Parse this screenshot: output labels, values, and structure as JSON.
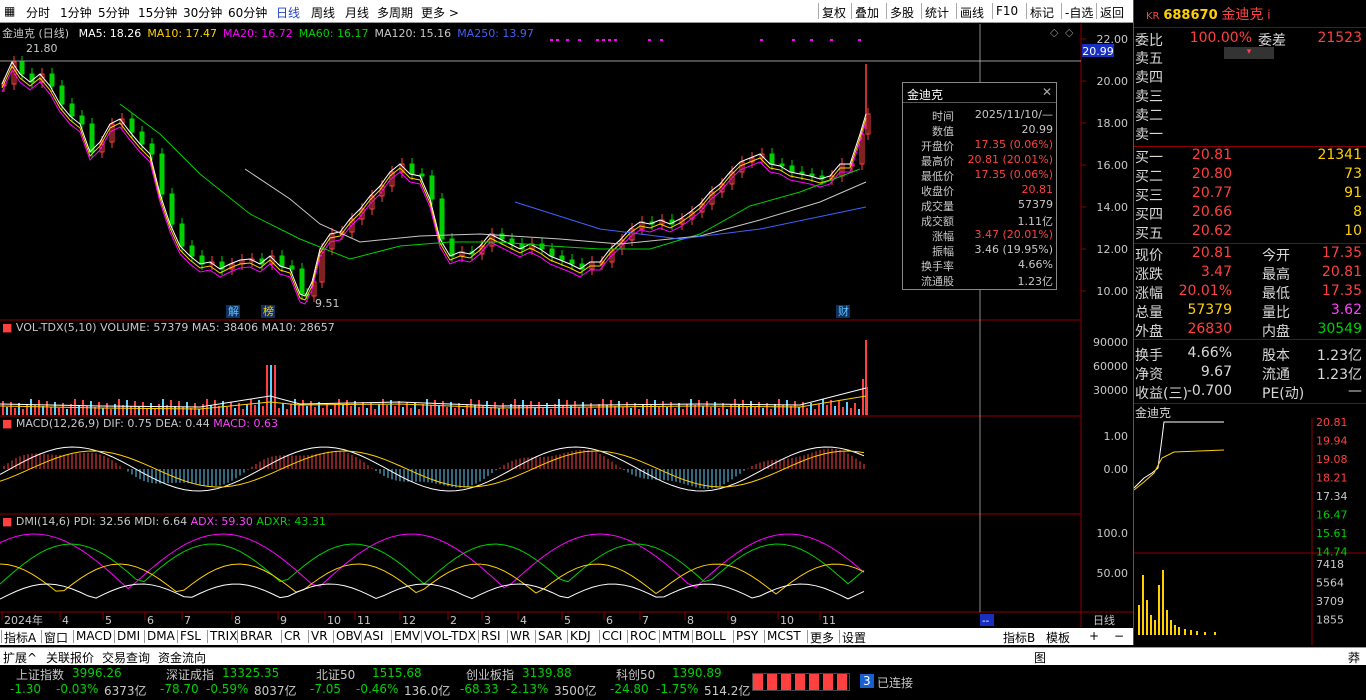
{
  "toolbar": {
    "periods": [
      "分时",
      "1分钟",
      "5分钟",
      "15分钟",
      "30分钟",
      "60分钟",
      "日线",
      "周线",
      "月线",
      "多周期",
      "更多 >"
    ],
    "active_period": "日线",
    "actions": [
      "复权",
      "叠加",
      "多股",
      "统计",
      "画线",
      "F10",
      "标记",
      "-自选",
      "返回"
    ]
  },
  "chart": {
    "title": "金迪克 (日线)",
    "ma": [
      {
        "label": "MA5: 18.26",
        "color": "#ffffff"
      },
      {
        "label": "MA10: 17.47",
        "color": "#ffd000"
      },
      {
        "label": "MA20: 16.72",
        "color": "#ff00ff"
      },
      {
        "label": "MA60: 16.17",
        "color": "#00d000"
      },
      {
        "label": "MA120: 15.16",
        "color": "#c8c8c8"
      },
      {
        "label": "MA250: 13.97",
        "color": "#4060ff"
      }
    ],
    "price_axis": [
      "22.00",
      "20.00",
      "18.00",
      "16.00",
      "14.00",
      "12.00",
      "10.00"
    ],
    "current_price_tag": "20.99",
    "high_label": "21.80",
    "low_label": "9.51",
    "peak_label": "21.80",
    "events": [
      "解",
      "榜",
      "财"
    ],
    "date_axis": [
      "2024年",
      "4",
      "5",
      "6",
      "7",
      "8",
      "9",
      "10",
      "11",
      "12",
      "2",
      "3",
      "4",
      "5",
      "6",
      "7",
      "8",
      "9",
      "10",
      "11"
    ],
    "timeframe_tag": "日线",
    "cursor_tag": "--"
  },
  "volume": {
    "title": "VOL-TDX(5,10)",
    "vol": "VOLUME: 57379",
    "ma5": "MA5: 38406",
    "ma10": "MA10: 28657",
    "axis": [
      "90000",
      "60000",
      "30000"
    ]
  },
  "macd": {
    "title": "MACD(12,26,9)",
    "dif": "DIF: 0.75",
    "dea": "DEA: 0.44",
    "macd": "MACD: 0.63",
    "axis": [
      "1.00",
      "0.00"
    ]
  },
  "dmi": {
    "title": "DMI(14,6)",
    "pdi": "PDI: 32.56",
    "mdi": "MDI: 6.64",
    "adx": "ADX: 59.30",
    "adxr": "ADXR: 43.31",
    "axis": [
      "100.0",
      "50.00"
    ]
  },
  "popup": {
    "title": "金迪克",
    "close_icon": "✕",
    "rows": [
      {
        "k": "时间",
        "v": "2025/11/10/—",
        "c": "#c8c8c8"
      },
      {
        "k": "数值",
        "v": "20.99",
        "c": "#c8c8c8"
      },
      {
        "k": "开盘价",
        "v": "17.35 (0.06%)",
        "c": "#ff4040"
      },
      {
        "k": "最高价",
        "v": "20.81 (20.01%)",
        "c": "#ff4040"
      },
      {
        "k": "最低价",
        "v": "17.35 (0.06%)",
        "c": "#ff4040"
      },
      {
        "k": "收盘价",
        "v": "20.81",
        "c": "#ff4040"
      },
      {
        "k": "成交量",
        "v": "57379",
        "c": "#c8c8c8"
      },
      {
        "k": "成交额",
        "v": "1.11亿",
        "c": "#c8c8c8"
      },
      {
        "k": "涨幅",
        "v": "3.47 (20.01%)",
        "c": "#ff4040"
      },
      {
        "k": "振幅",
        "v": "3.46 (19.95%)",
        "c": "#c8c8c8"
      },
      {
        "k": "换手率",
        "v": "4.66%",
        "c": "#c8c8c8"
      },
      {
        "k": "流通股",
        "v": "1.23亿",
        "c": "#c8c8c8"
      }
    ]
  },
  "quote": {
    "kr": "KR",
    "code": "688670",
    "name": "金迪克",
    "info": "i",
    "weibi_label": "委比",
    "weibi": "100.00%",
    "weicha_label": "委差",
    "weicha": "21523",
    "sells": [
      {
        "l": "卖五",
        "p": "",
        "q": ""
      },
      {
        "l": "卖四",
        "p": "",
        "q": ""
      },
      {
        "l": "卖三",
        "p": "",
        "q": ""
      },
      {
        "l": "卖二",
        "p": "",
        "q": ""
      },
      {
        "l": "卖一",
        "p": "",
        "q": ""
      }
    ],
    "buys": [
      {
        "l": "买一",
        "p": "20.81",
        "q": "21341"
      },
      {
        "l": "买二",
        "p": "20.80",
        "q": "73"
      },
      {
        "l": "买三",
        "p": "20.77",
        "q": "91"
      },
      {
        "l": "买四",
        "p": "20.66",
        "q": "8"
      },
      {
        "l": "买五",
        "p": "20.62",
        "q": "10"
      }
    ],
    "stats": [
      {
        "a": "现价",
        "av": "20.81",
        "ac": "#ff4040",
        "b": "今开",
        "bv": "17.35",
        "bc": "#ff4040"
      },
      {
        "a": "涨跌",
        "av": "3.47",
        "ac": "#ff4040",
        "b": "最高",
        "bv": "20.81",
        "bc": "#ff4040"
      },
      {
        "a": "涨幅",
        "av": "20.01%",
        "ac": "#ff4040",
        "b": "最低",
        "bv": "17.35",
        "bc": "#ff4040"
      },
      {
        "a": "总量",
        "av": "57379",
        "ac": "#ffd000",
        "b": "量比",
        "bv": "3.62",
        "bc": "#ff40ff"
      },
      {
        "a": "外盘",
        "av": "26830",
        "ac": "#ff4040",
        "b": "内盘",
        "bv": "30549",
        "bc": "#00d000"
      },
      {
        "a": "换手",
        "av": "4.66%",
        "ac": "#d8d8d8",
        "b": "股本",
        "bv": "1.23亿",
        "bc": "#d8d8d8"
      },
      {
        "a": "净资",
        "av": "9.67",
        "ac": "#d8d8d8",
        "b": "流通",
        "bv": "1.23亿",
        "bc": "#d8d8d8"
      },
      {
        "a": "收益(三)",
        "av": "-0.700",
        "ac": "#d8d8d8",
        "b": "PE(动)",
        "bv": "—",
        "bc": "#d8d8d8"
      }
    ],
    "mini_title": "金迪克",
    "mini_axis": [
      {
        "v": "20.81",
        "c": "#ff4040"
      },
      {
        "v": "19.94",
        "c": "#ff4040"
      },
      {
        "v": "19.08",
        "c": "#ff4040"
      },
      {
        "v": "18.21",
        "c": "#ff4040"
      },
      {
        "v": "17.34",
        "c": "#c8c8c8"
      },
      {
        "v": "16.47",
        "c": "#00d000"
      },
      {
        "v": "15.61",
        "c": "#00d000"
      },
      {
        "v": "14.74",
        "c": "#00d000"
      }
    ],
    "mini_vol_axis": [
      "7418",
      "5564",
      "3709",
      "1855"
    ]
  },
  "tabs": [
    "指标A",
    "窗口",
    "MACD",
    "DMI",
    "DMA",
    "FSL",
    "TRIX",
    "BRAR",
    "CR",
    "VR",
    "OBV",
    "ASI",
    "EMV",
    "VOL-TDX",
    "RSI",
    "WR",
    "SAR",
    "KDJ",
    "CCI",
    "ROC",
    "MTM",
    "BOLL",
    "PSY",
    "MCST",
    "更多",
    "设置"
  ],
  "tabs_right": [
    "指标B",
    "模板",
    "+",
    "−"
  ],
  "ext": [
    "扩展^",
    "关联报价",
    "交易查询",
    "资金流向"
  ],
  "ext_right": "图",
  "ext_far": "莽",
  "indices": [
    {
      "name": "上证指数",
      "value": "3996.26",
      "chg": "-1.30",
      "pct": "-0.03%",
      "amt": "6373亿"
    },
    {
      "name": "深证成指",
      "value": "13325.35",
      "chg": "-78.70",
      "pct": "-0.59%",
      "amt": "8037亿"
    },
    {
      "name": "北证50",
      "value": "1515.68",
      "chg": "-7.05",
      "pct": "-0.46%",
      "amt": "136.0亿"
    },
    {
      "name": "创业板指",
      "value": "3139.88",
      "chg": "-68.33",
      "pct": "-2.13%",
      "amt": "3500亿"
    },
    {
      "name": "科创50",
      "value": "1390.89",
      "chg": "-24.80",
      "pct": "-1.75%",
      "amt": "514.2亿"
    }
  ],
  "connection": {
    "count": "3",
    "label": "已连接"
  },
  "colors": {
    "up": "#ff4040",
    "down": "#00d000",
    "vol": "#ffd000"
  }
}
